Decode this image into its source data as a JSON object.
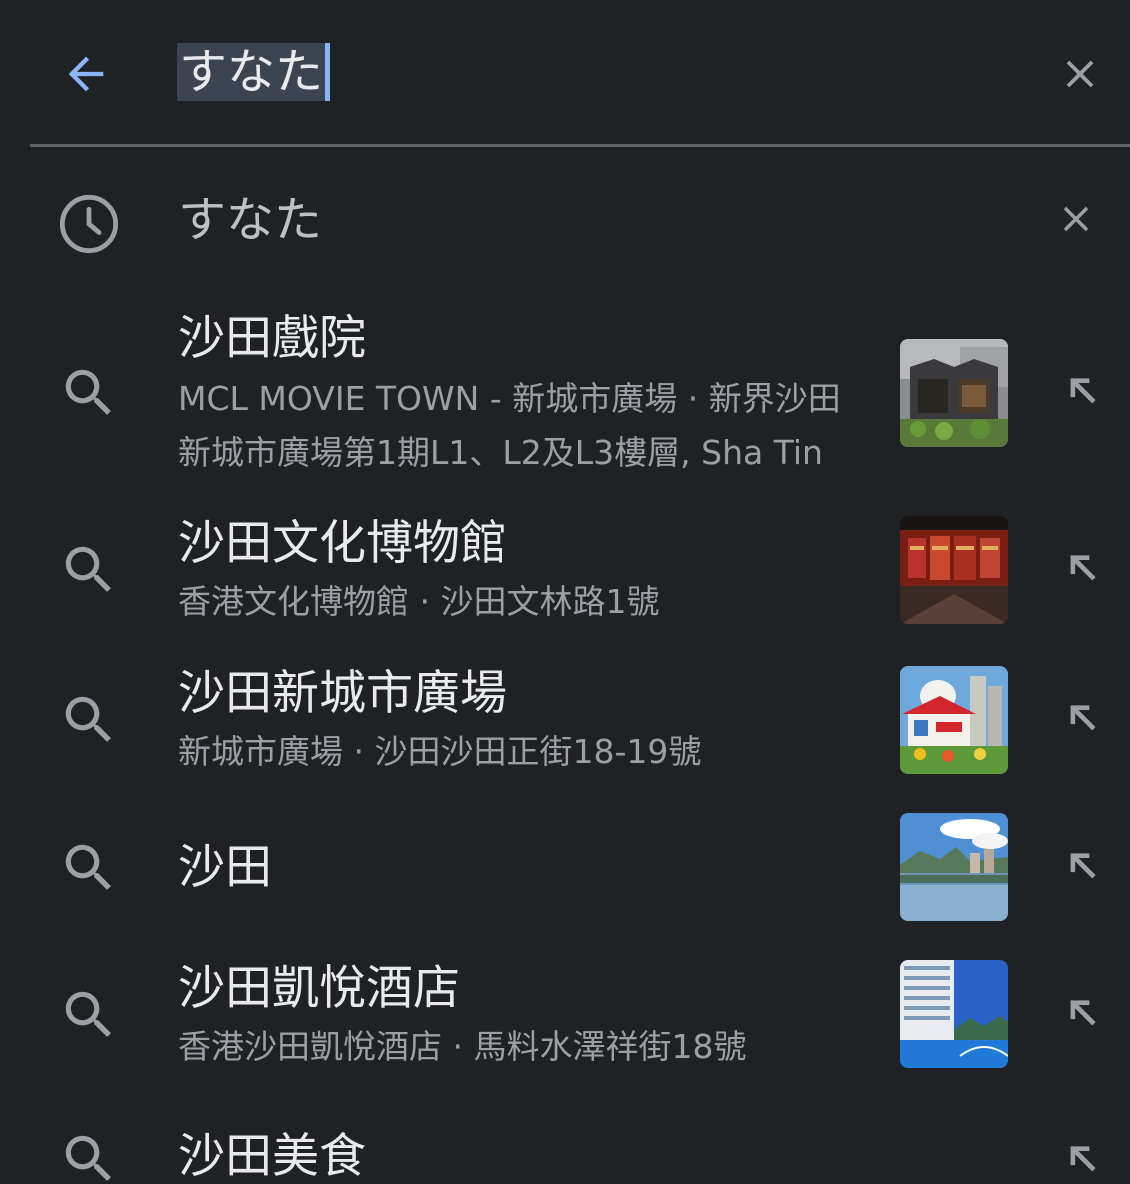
{
  "search": {
    "query": "すなた"
  },
  "history": {
    "text": "すなた"
  },
  "suggestions": [
    {
      "title": "沙田戲院",
      "sub1": "MCL MOVIE TOWN - 新城市廣場 · 新界沙田",
      "sub2": "新城市廣場第1期L1、L2及L3樓層, Sha Tin"
    },
    {
      "title": "沙田文化博物館",
      "sub1": "香港文化博物館 · 沙田文林路1號"
    },
    {
      "title": "沙田新城市廣場",
      "sub1": "新城市廣場 · 沙田沙田正街18-19號"
    },
    {
      "title": "沙田"
    },
    {
      "title": "沙田凱悅酒店",
      "sub1": "香港沙田凱悅酒店 · 馬料水澤祥街18號"
    },
    {
      "title": "沙田美食"
    }
  ],
  "colors": {
    "background": "#202124",
    "accent": "#8ab4f8",
    "icon": "#9aa0a6",
    "text_primary": "#e8eaed",
    "text_secondary": "#9aa0a6"
  }
}
